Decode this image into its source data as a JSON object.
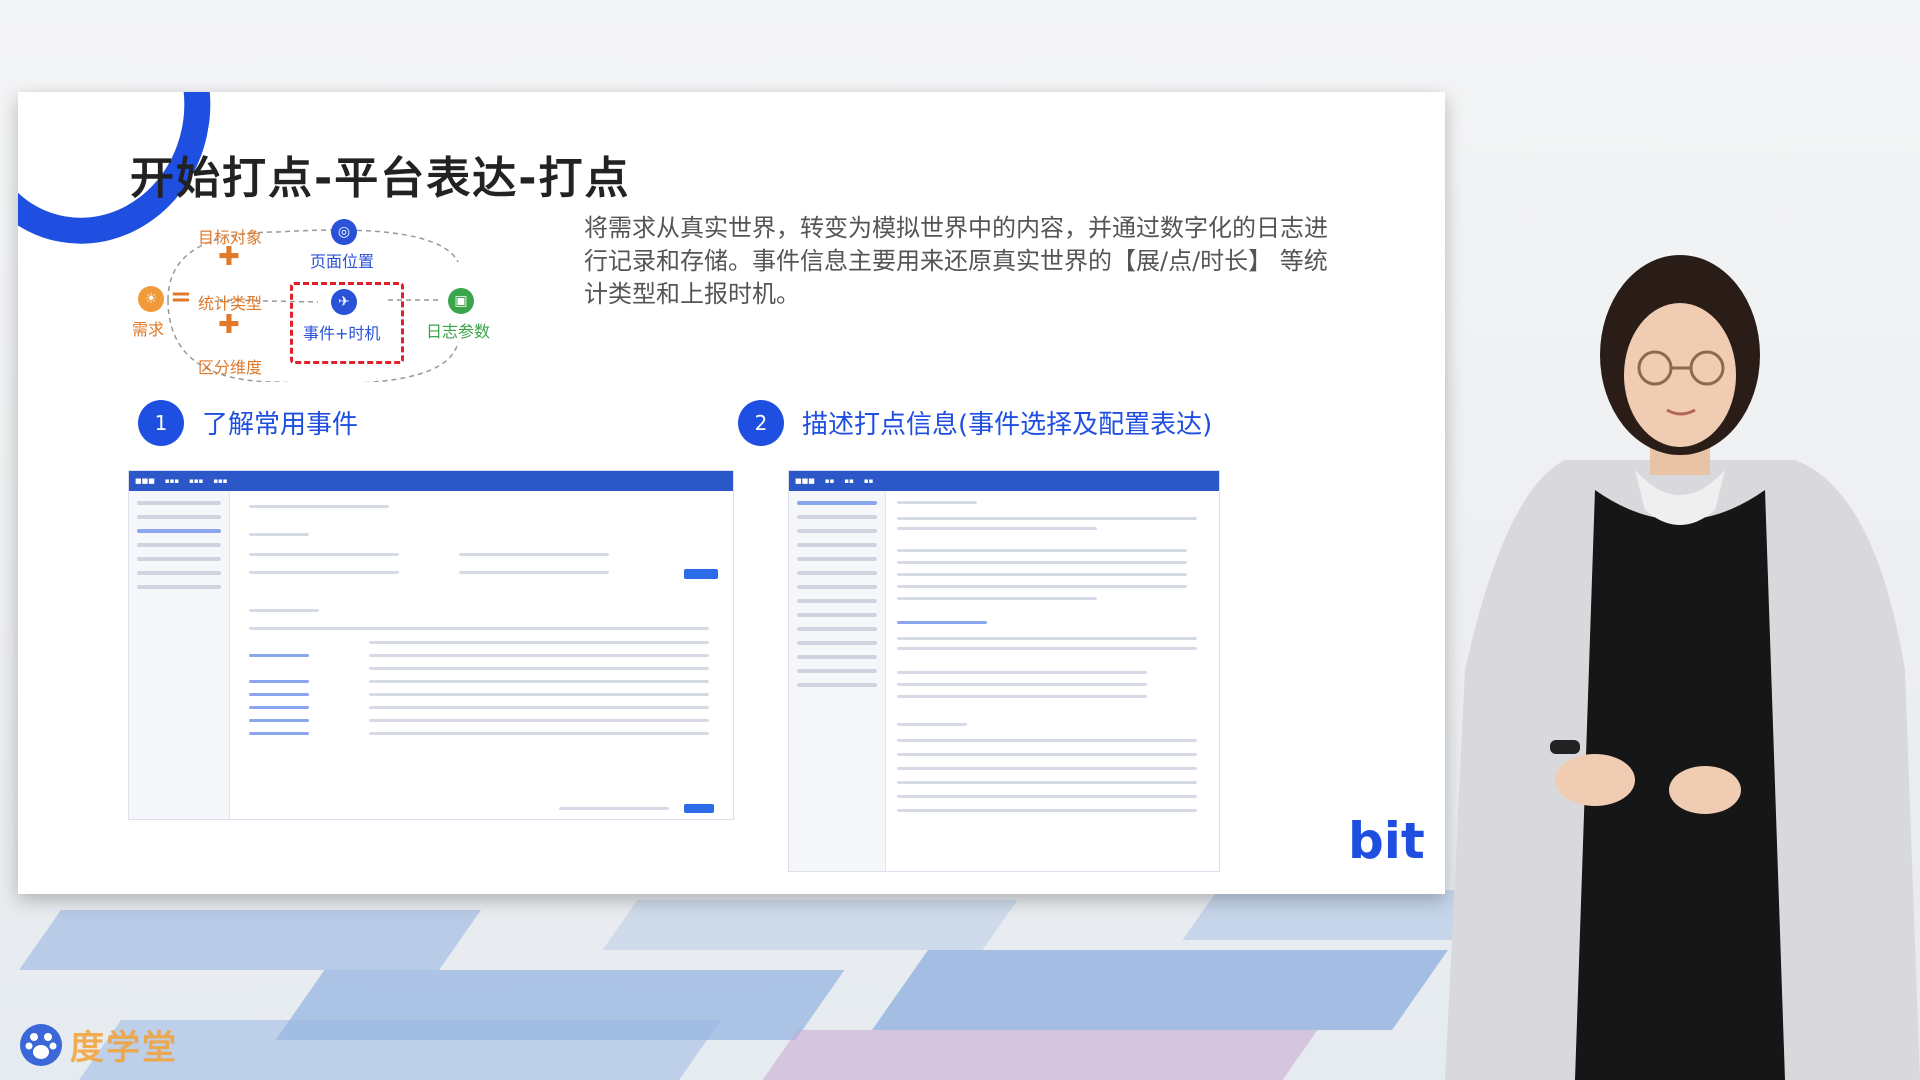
{
  "slide": {
    "title": "开始打点-平台表达-打点",
    "description": "将需求从真实世界，转变为模拟世界中的内容，并通过数字化的日志进行记录和存储。事件信息主要用来还原真实世界的【展/点/时长】 等统计类型和上报时机。",
    "diagram": {
      "demand": "需求",
      "target_object": "目标对象",
      "stat_type": "统计类型",
      "dimension": "区分维度",
      "page_position": "页面位置",
      "event_timing": "事件+时机",
      "log_params": "日志参数"
    },
    "steps": [
      {
        "number": "1",
        "label": "了解常用事件"
      },
      {
        "number": "2",
        "label": "描述打点信息(事件选择及配置表达)"
      }
    ],
    "logo": "bit"
  },
  "brand": {
    "name": "度学堂"
  },
  "colors": {
    "accent": "#1f4fe0",
    "orange": "#e0792a",
    "red_dash": "#e0202a",
    "green": "#3aa54a"
  }
}
